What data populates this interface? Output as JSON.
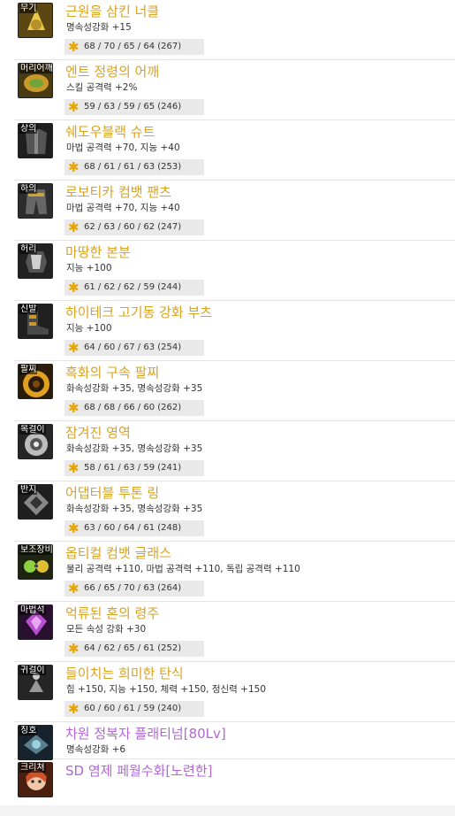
{
  "colors": {
    "unique": "#d9a21f",
    "epic": "#b266d6",
    "star": "#e8a400"
  },
  "items": [
    {
      "slot": "무기",
      "name": "근원을 삼킨 너클",
      "option": "명속성강화 +15",
      "stats": "68 / 70 / 65 / 64 (267)",
      "icon": "knuckle-icon",
      "bg": "#6b5416",
      "fg": "#e8c94a"
    },
    {
      "slot": "머리어깨",
      "name": "엔트 정령의 어깨",
      "option": "스킬 공격력 +2%",
      "stats": "59 / 63 / 59 / 65 (246)",
      "icon": "shoulder-icon",
      "bg": "#5a4b1a",
      "fg": "#6fa53a"
    },
    {
      "slot": "상의",
      "name": "쉐도우블랙 슈트",
      "option": "마법 공격력 +70, 지능 +40",
      "stats": "68 / 61 / 61 / 63 (253)",
      "icon": "top-armor-icon",
      "bg": "#2a2a2a",
      "fg": "#777777"
    },
    {
      "slot": "하의",
      "name": "로보티카 컴뱃 팬츠",
      "option": "마법 공격력 +70, 지능 +40",
      "stats": "62 / 63 / 60 / 62 (247)",
      "icon": "pants-icon",
      "bg": "#3a3a3a",
      "fg": "#c9a43a"
    },
    {
      "slot": "허리",
      "name": "마땅한 본분",
      "option": "지능 +100",
      "stats": "61 / 62 / 62 / 59 (244)",
      "icon": "belt-icon",
      "bg": "#2e2e2e",
      "fg": "#cfcfcf"
    },
    {
      "slot": "신발",
      "name": "하이테크 고기동 강화 부츠",
      "option": "지능 +100",
      "stats": "64 / 60 / 67 / 63 (254)",
      "icon": "boots-icon",
      "bg": "#2b2b2b",
      "fg": "#c99a2a"
    },
    {
      "slot": "팔찌",
      "name": "흑화의 구속 팔찌",
      "option": "화속성강화 +35, 명속성강화 +35",
      "stats": "68 / 68 / 66 / 60 (262)",
      "icon": "bracelet-icon",
      "bg": "#3d2a10",
      "fg": "#e0a020"
    },
    {
      "slot": "목걸이",
      "name": "잠겨진 영역",
      "option": "화속성강화 +35, 명속성강화 +35",
      "stats": "58 / 61 / 63 / 59 (241)",
      "icon": "necklace-icon",
      "bg": "#333333",
      "fg": "#dddddd"
    },
    {
      "slot": "반지",
      "name": "어댑터블 투톤 링",
      "option": "화속성강화 +35, 명속성강화 +35",
      "stats": "63 / 60 / 64 / 61 (248)",
      "icon": "ring-icon",
      "bg": "#2c2c2c",
      "fg": "#bbbbbb"
    },
    {
      "slot": "보조장비",
      "name": "옵티컬 컴뱃 글래스",
      "option": "물리 공격력 +110, 마법 공격력 +110, 독립 공격력 +110",
      "stats": "66 / 65 / 70 / 63 (264)",
      "icon": "glasses-icon",
      "bg": "#2f3a1c",
      "fg": "#8fd040"
    },
    {
      "slot": "마법석",
      "name": "억류된 혼의 령주",
      "option": "모든 속성 강화 +30",
      "stats": "64 / 62 / 65 / 61 (252)",
      "icon": "magic-stone-icon",
      "bg": "#3a1840",
      "fg": "#b84fd0"
    },
    {
      "slot": "귀걸이",
      "name": "들이치는 희미한 탄식",
      "option": "힘 +150, 지능 +150, 체력 +150, 정신력 +150",
      "stats": "60 / 60 / 61 / 59 (240)",
      "icon": "earring-icon",
      "bg": "#333333",
      "fg": "#cccccc"
    },
    {
      "slot": "칭호",
      "name": "차원 정복자 플래티넘[80Lv]",
      "option": "명속성강화 +6",
      "stats": "",
      "icon": "title-icon",
      "bg": "#1f2f3a",
      "fg": "#9ad0e0"
    },
    {
      "slot": "크리쳐",
      "name": "SD 염제 페월수화[노련한]",
      "option": "",
      "stats": "",
      "icon": "creature-icon",
      "bg": "#5a2a18",
      "fg": "#e07040"
    }
  ]
}
